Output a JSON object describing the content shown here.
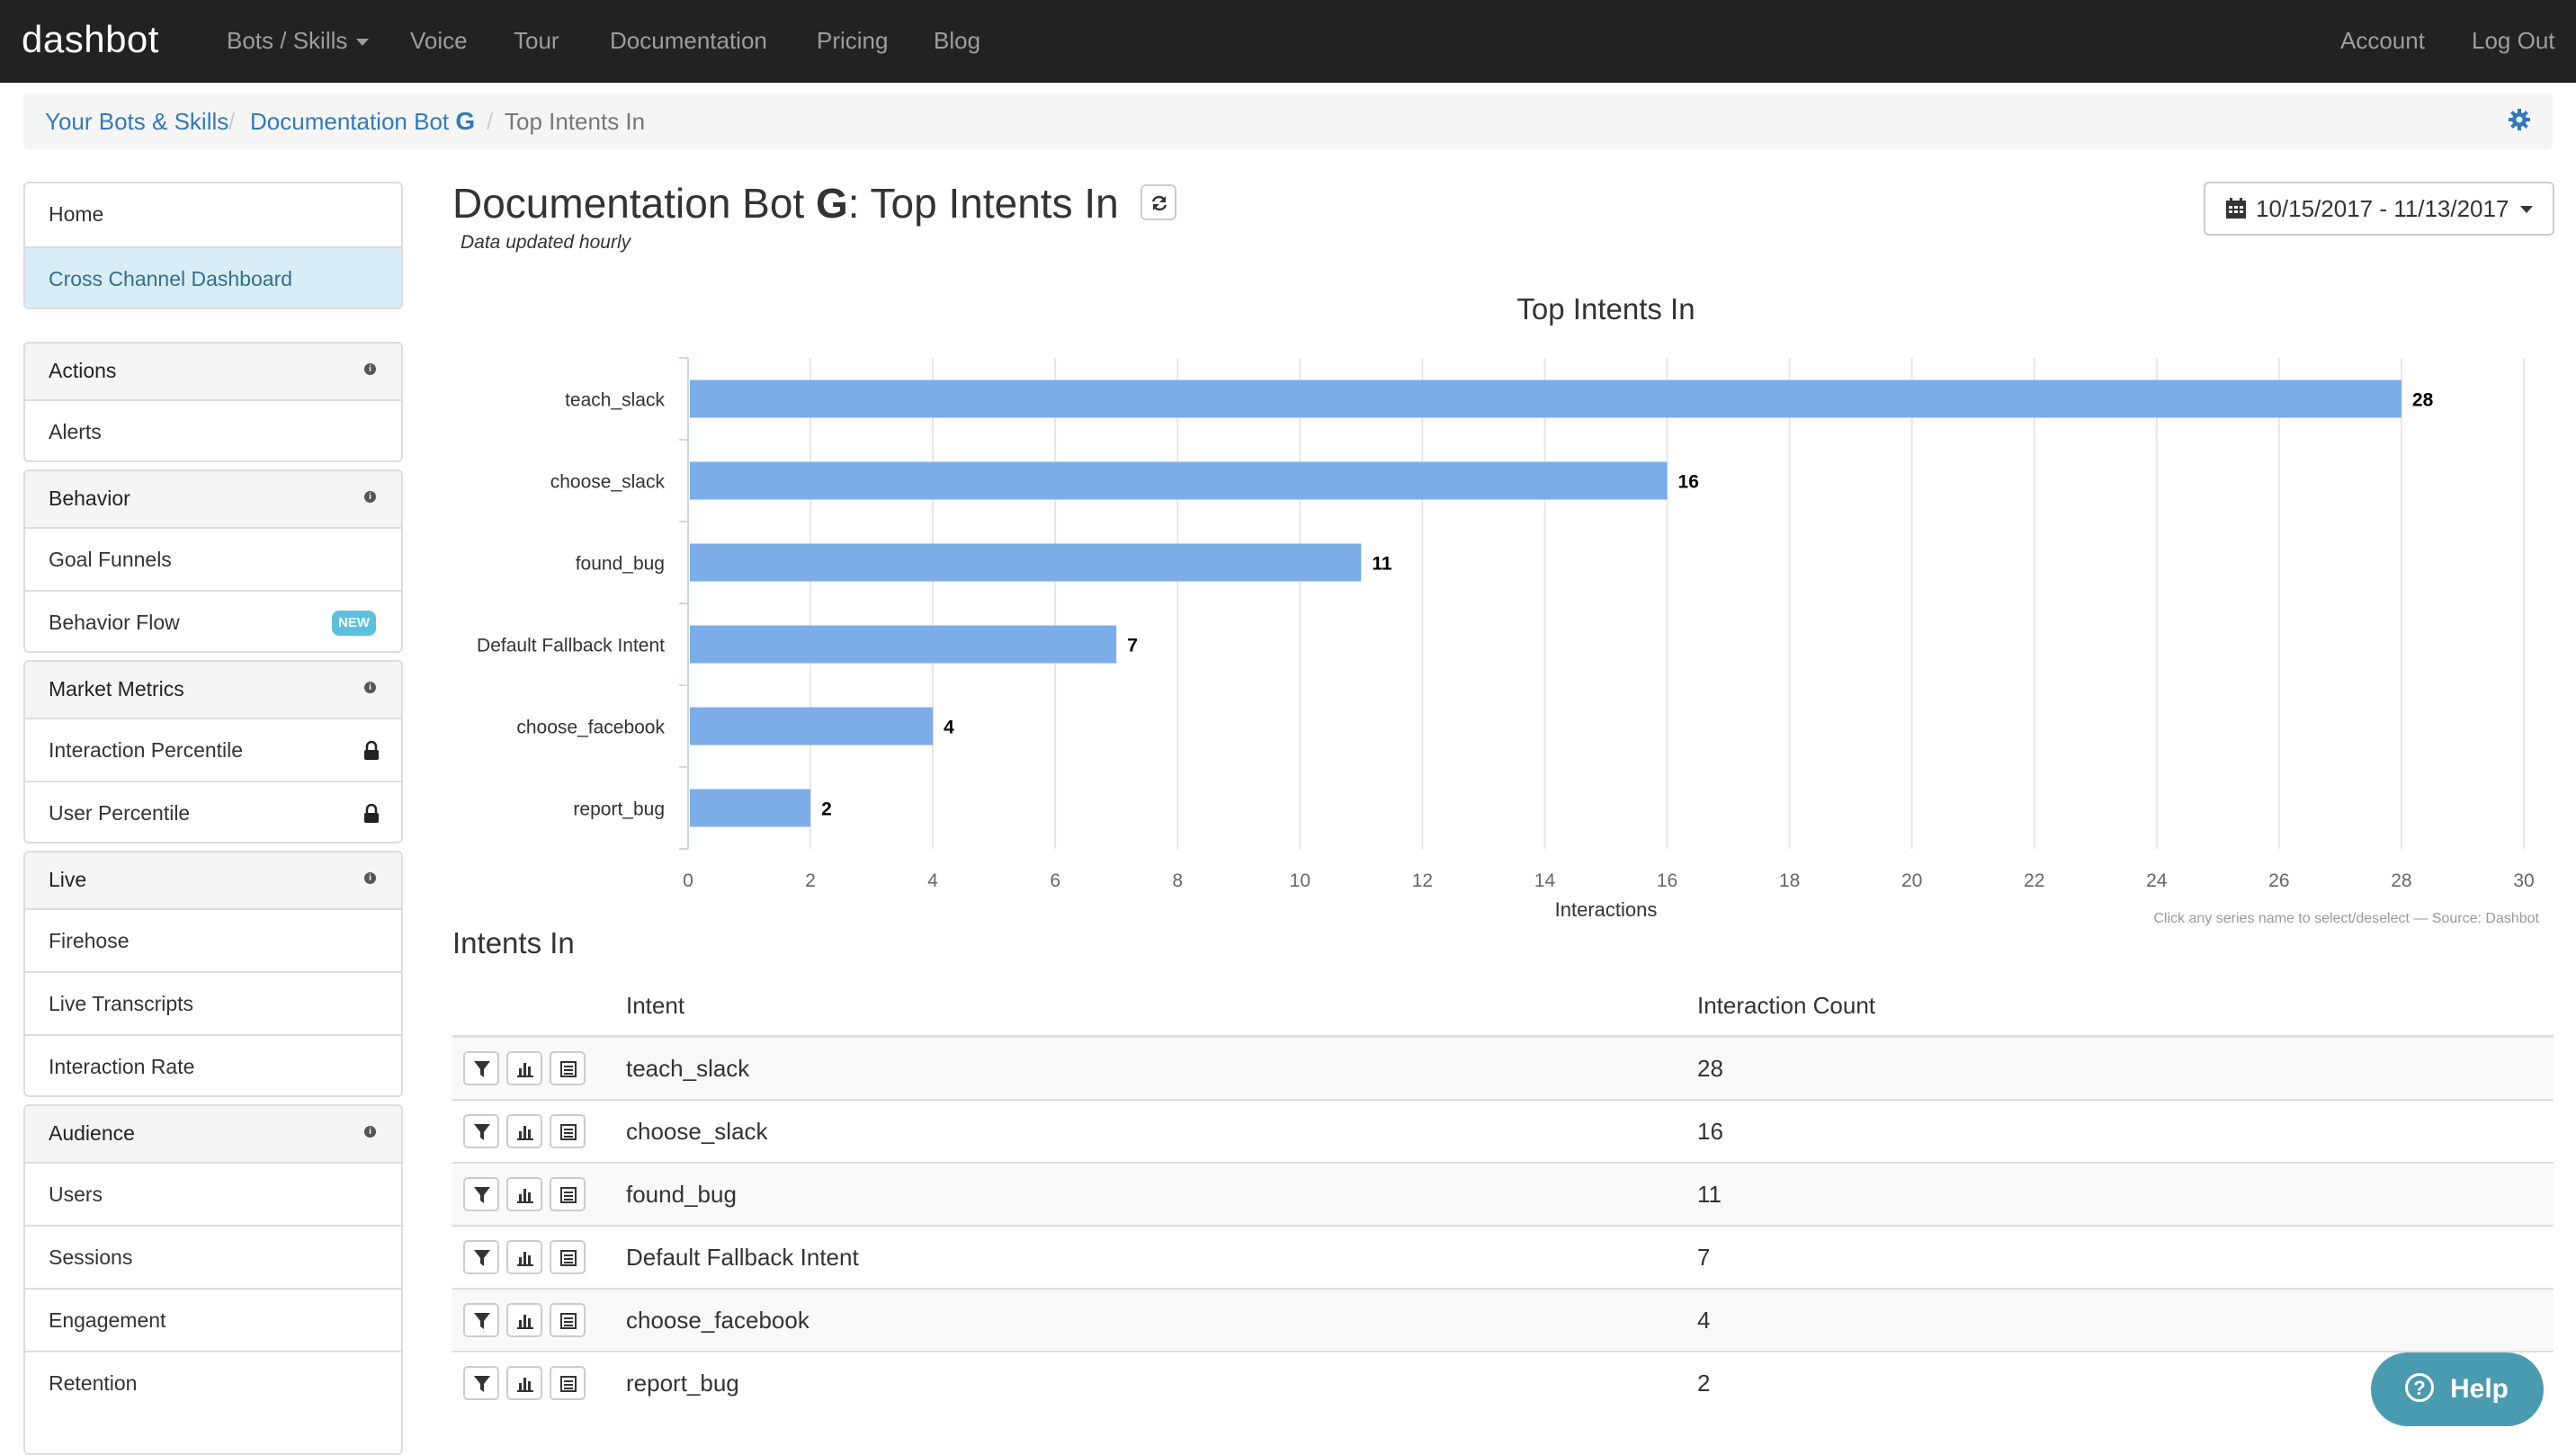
{
  "navbar": {
    "brand": "dashbot",
    "items": [
      {
        "label": "Bots / Skills",
        "dropdown": true
      },
      {
        "label": "Voice"
      },
      {
        "label": "Tour"
      },
      {
        "label": "Documentation"
      },
      {
        "label": "Pricing"
      },
      {
        "label": "Blog"
      }
    ],
    "right": [
      {
        "label": "Account"
      },
      {
        "label": "Log Out"
      }
    ]
  },
  "breadcrumb": {
    "items": [
      "Your Bots & Skills",
      "Documentation Bot",
      "Top Intents In"
    ],
    "bot_platform_icon": "google-g-icon",
    "settings_icon": "gear-icon"
  },
  "sidebar": {
    "top": [
      {
        "label": "Home",
        "selected": false
      },
      {
        "label": "Cross Channel Dashboard",
        "selected": true
      }
    ],
    "groups": [
      {
        "title": "Actions",
        "items": [
          {
            "label": "Alerts"
          }
        ]
      },
      {
        "title": "Behavior",
        "items": [
          {
            "label": "Goal Funnels"
          },
          {
            "label": "Behavior Flow",
            "badge": "NEW"
          }
        ]
      },
      {
        "title": "Market Metrics",
        "items": [
          {
            "label": "Interaction Percentile",
            "icon": "lock-icon"
          },
          {
            "label": "User Percentile",
            "icon": "lock-icon"
          }
        ]
      },
      {
        "title": "Live",
        "items": [
          {
            "label": "Firehose"
          },
          {
            "label": "Live Transcripts"
          },
          {
            "label": "Interaction Rate"
          }
        ]
      },
      {
        "title": "Audience",
        "items": [
          {
            "label": "Users"
          },
          {
            "label": "Sessions"
          },
          {
            "label": "Engagement"
          },
          {
            "label": "Retention"
          }
        ]
      }
    ],
    "info_glyph": "i"
  },
  "header": {
    "bot_name": "Documentation Bot",
    "g_glyph": "G",
    "title_suffix": ": Top Intents In",
    "updated_note": "Data updated hourly",
    "date_range": "10/15/2017 - 11/13/2017"
  },
  "chart_data": {
    "type": "bar",
    "orientation": "horizontal",
    "title": "Top Intents In",
    "categories": [
      "teach_slack",
      "choose_slack",
      "found_bug",
      "Default Fallback Intent",
      "choose_facebook",
      "report_bug"
    ],
    "values": [
      28,
      16,
      11,
      7,
      4,
      2
    ],
    "xlabel": "Interactions",
    "ylabel": "",
    "xlim": [
      0,
      30
    ],
    "xticks": [
      0,
      2,
      4,
      6,
      8,
      10,
      12,
      14,
      16,
      18,
      20,
      22,
      24,
      26,
      28,
      30
    ],
    "grid": true,
    "data_labels": true,
    "bar_color": "#7cade8",
    "credits": "Click any series name to select/deselect — Source: Dashbot"
  },
  "table": {
    "title": "Intents In",
    "columns": [
      "Intent",
      "Interaction Count"
    ],
    "rows": [
      {
        "intent": "teach_slack",
        "count": "28"
      },
      {
        "intent": "choose_slack",
        "count": "16"
      },
      {
        "intent": "found_bug",
        "count": "11"
      },
      {
        "intent": "Default Fallback Intent",
        "count": "7"
      },
      {
        "intent": "choose_facebook",
        "count": "4"
      },
      {
        "intent": "report_bug",
        "count": "2"
      }
    ],
    "row_actions": [
      "filter-icon",
      "bar-chart-icon",
      "list-icon"
    ]
  },
  "help": {
    "label": "Help"
  },
  "colors": {
    "navbar": "#222222",
    "link": "#337ab7",
    "selected_bg": "#d9edf7",
    "bar": "#7cade8",
    "help": "#4a9bb0",
    "badge": "#5bc0de"
  }
}
